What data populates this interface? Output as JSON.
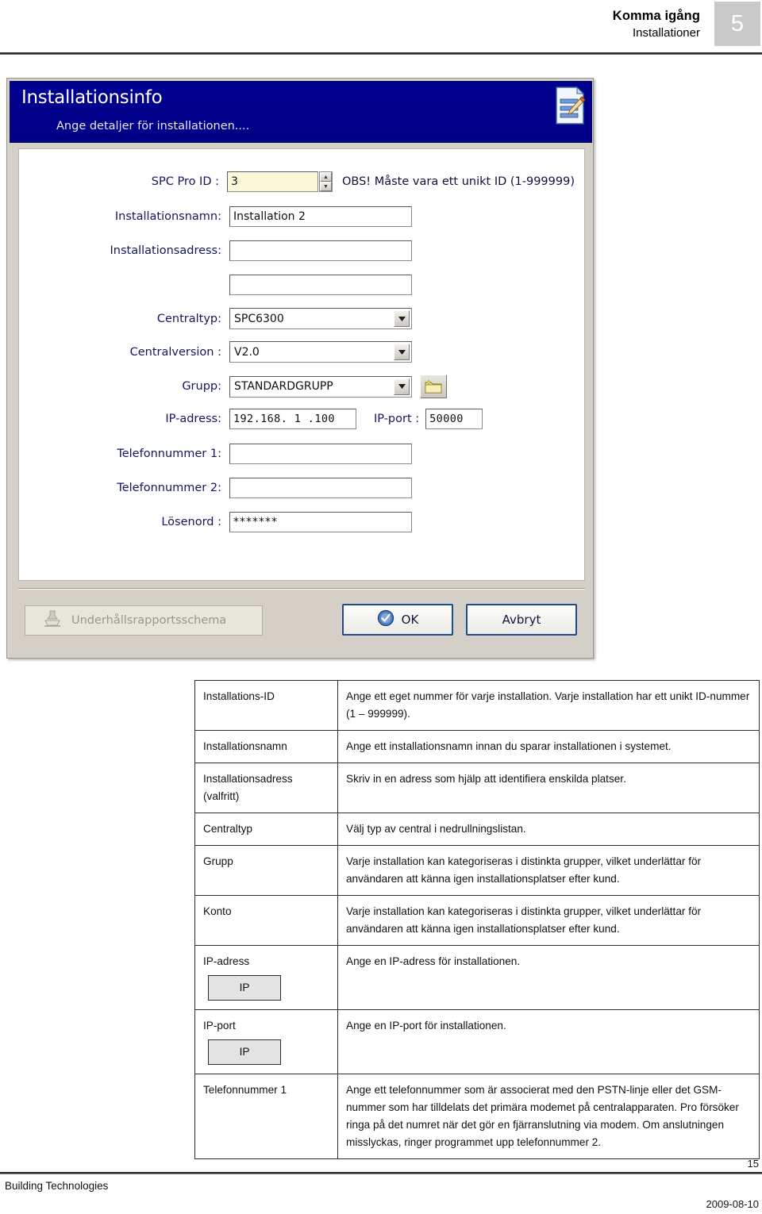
{
  "header": {
    "title": "Komma igång",
    "subtitle": "Installationer",
    "chapter": "5"
  },
  "dialog": {
    "banner_title": "Installationsinfo",
    "banner_subtitle": "Ange detaljer för installationen....",
    "banner_icon": "document-edit-icon",
    "fields": {
      "spc_pro_id_label": "SPC Pro ID :",
      "spc_pro_id_value": "3",
      "spc_pro_id_hint": "OBS! Måste vara ett unikt ID (1-999999)",
      "installation_name_label": "Installationsnamn:",
      "installation_name_value": "Installation 2",
      "installation_address_label": "Installationsadress:",
      "installation_address_value": "",
      "installation_address2_value": "",
      "panel_type_label": "Centraltyp:",
      "panel_type_value": "SPC6300",
      "panel_version_label": "Centralversion :",
      "panel_version_value": "V2.0",
      "group_label": "Grupp:",
      "group_value": "STANDARDGRUPP",
      "group_new_folder_icon": "new-folder-icon",
      "ip_address_label": "IP-adress:",
      "ip_address_value": "192.168.  1  .100",
      "ip_port_label": "IP-port :",
      "ip_port_value": "50000",
      "phone1_label": "Telefonnummer 1:",
      "phone1_value": "",
      "phone2_label": "Telefonnummer 2:",
      "phone2_value": "",
      "password_label": "Lösenord :",
      "password_value": "*******"
    },
    "buttons": {
      "maintenance": "Underhållsrapportsschema",
      "maintenance_icon": "stamp-icon",
      "ok": "OK",
      "ok_icon": "check-circle-icon",
      "cancel": "Avbryt"
    }
  },
  "table": {
    "rows": [
      {
        "key": "Installations-ID",
        "badge": null,
        "desc": "Ange ett eget nummer för varje installation. Varje installation har ett unikt ID-nummer (1 – 999999)."
      },
      {
        "key": "Installationsnamn",
        "badge": null,
        "desc": "Ange ett installationsnamn innan du sparar installationen i systemet."
      },
      {
        "key": "Installationsadress (valfritt)",
        "badge": null,
        "desc": "Skriv in en adress som hjälp att identifiera enskilda platser."
      },
      {
        "key": "Centraltyp",
        "badge": null,
        "desc": "Välj typ av central i nedrullningslistan."
      },
      {
        "key": "Grupp",
        "badge": null,
        "desc": "Varje installation kan kategoriseras i distinkta grupper, vilket underlättar för användaren att känna igen installationsplatser efter kund."
      },
      {
        "key": "Konto",
        "badge": null,
        "desc": "Varje installation kan kategoriseras i distinkta grupper, vilket underlättar för användaren att känna igen installationsplatser efter kund."
      },
      {
        "key": "IP-adress",
        "badge": "IP",
        "desc": "Ange en IP-adress för installationen."
      },
      {
        "key": "IP-port",
        "badge": "IP",
        "desc": "Ange en IP-port för installationen."
      },
      {
        "key": "Telefonnummer 1",
        "badge": null,
        "desc": "Ange ett telefonnummer som är associerat med den PSTN-linje eller det GSM-nummer som har tilldelats det primära modemet på  centralapparaten. Pro försöker ringa på det numret när det gör en fjärranslutning via modem. Om anslutningen misslyckas, ringer programmet upp telefonnummer 2."
      }
    ]
  },
  "footer": {
    "page_number": "15",
    "left": "Building Technologies",
    "date": "2009-08-10"
  },
  "colors": {
    "banner_blue": "#00008f",
    "label_navy": "#151560",
    "chapter_grey": "#c9c9c9",
    "dialog_face": "#d4d0c8",
    "spin_field_yellow": "#fbf8d8"
  }
}
